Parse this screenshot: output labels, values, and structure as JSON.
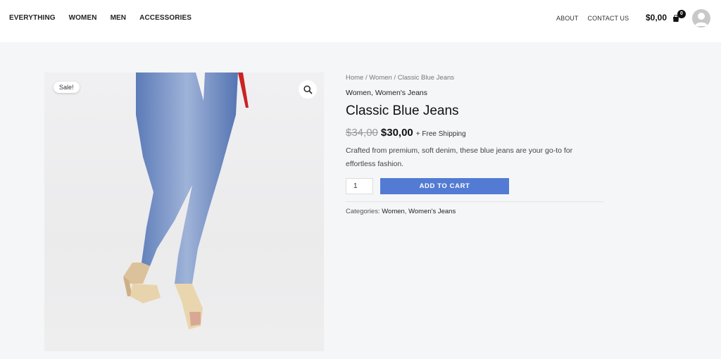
{
  "header": {
    "nav_left": [
      "EVERYTHING",
      "WOMEN",
      "MEN",
      "ACCESSORIES"
    ],
    "nav_right": [
      "ABOUT",
      "CONTACT US"
    ],
    "cart_total": "$0,00",
    "cart_count": "0"
  },
  "product": {
    "sale_badge": "Sale!",
    "breadcrumb": [
      "Home",
      "Women",
      "Classic Blue Jeans"
    ],
    "breadcrumb_sep": " / ",
    "categories_top": "Women, Women's Jeans",
    "title": "Classic Blue Jeans",
    "old_price": "$34,00",
    "new_price": "$30,00",
    "shipping": "+ Free Shipping",
    "description": "Crafted from premium, soft denim, these blue jeans are your go-to for effortless fashion.",
    "quantity": "1",
    "add_to_cart": "ADD TO CART",
    "meta_label": "Categories:",
    "meta_categories": [
      "Women",
      "Women's Jeans"
    ]
  },
  "colors": {
    "accent": "#537bd4",
    "background": "#f5f6f8"
  }
}
